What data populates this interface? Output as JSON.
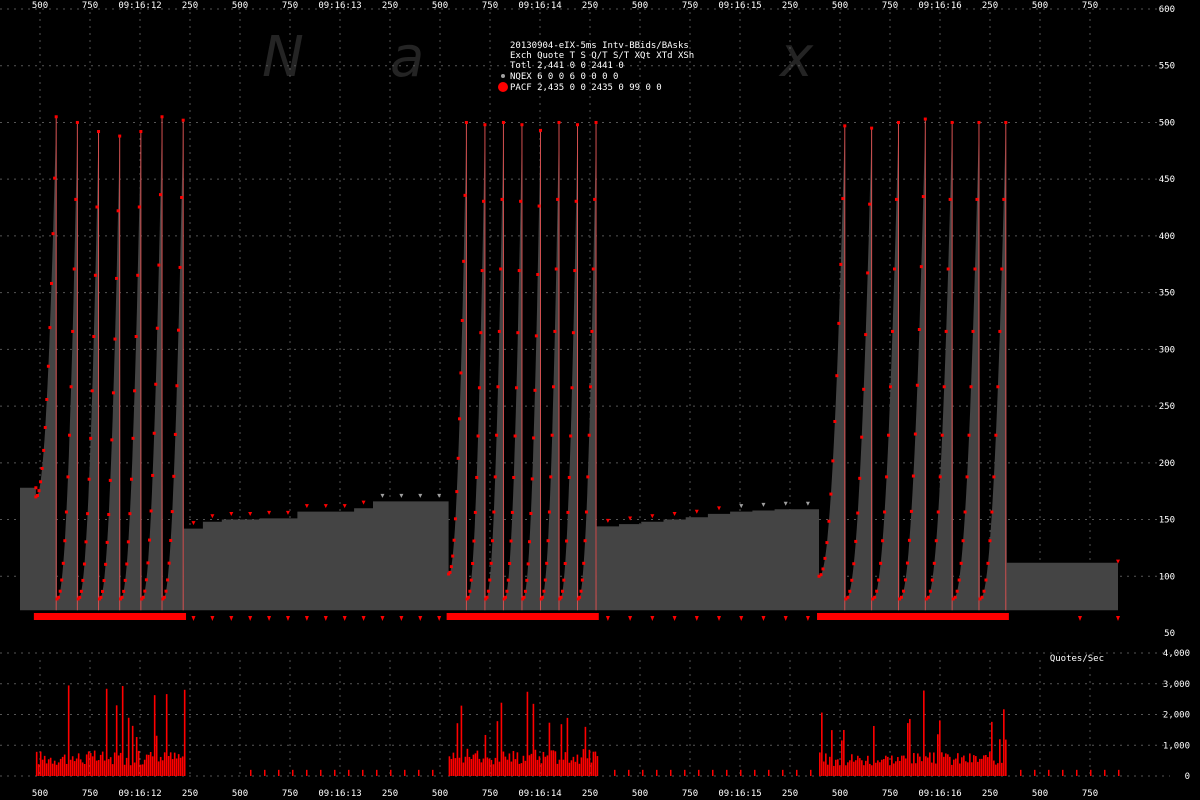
{
  "watermark": [
    "N",
    "a",
    "x"
  ],
  "legend": {
    "title": "20130904-eIX-5ms Intv-BBids/BAsks",
    "header": "Exch Quote T S  Q/T    S/T   XQt XTd XSh",
    "rows": [
      {
        "text": "Totl 2,441 0 0  2441      0",
        "marker": "none"
      },
      {
        "text": "NQEX     6 0 0     6      0   0   0   0",
        "marker": "small-gray-dot"
      },
      {
        "text": "PACF 2,435 0 0  2435      0  99   0   0",
        "marker": "large-red-dot"
      }
    ]
  },
  "colors": {
    "background": "#000000",
    "price_fill": "#444444",
    "pacf": "#ff0000",
    "nqex": "#a0a0a0",
    "grid": "#555555",
    "text": "#ffffff"
  },
  "chart_data": [
    {
      "type": "area",
      "description": "Top panel: stepped price level with quote markers (PACF red, NQEX gray); 5 sawtooth bursts ~500 to ~100 with flat ramps between",
      "y_ticks": [
        "600",
        "550",
        "500",
        "450",
        "400",
        "350",
        "300",
        "250",
        "200",
        "150",
        "100",
        "50"
      ],
      "ylim": [
        50,
        600
      ],
      "x_tick_labels": [
        "500",
        "750",
        "09:16:12",
        "250",
        "500",
        "750",
        "09:16:13",
        "250",
        "500",
        "750",
        "09:16:14",
        "250",
        "500",
        "750",
        "09:16:15",
        "250",
        "500",
        "750",
        "09:16:16",
        "250",
        "500",
        "750"
      ],
      "time_range_ms": [
        0,
        5400
      ],
      "base_level": 70,
      "segments": [
        {
          "kind": "flat",
          "t": [
            0,
            60
          ],
          "value": 178
        },
        {
          "kind": "sawtooth",
          "t": [
            60,
            620
          ],
          "low": 170,
          "peaks": [
            505,
            500,
            492,
            488,
            492,
            505,
            502
          ]
        },
        {
          "kind": "staircase",
          "t": [
            620,
            1620
          ],
          "steps": [
            142,
            148,
            150,
            150,
            151,
            151,
            157,
            157,
            157,
            160,
            166,
            166,
            166,
            166
          ]
        },
        {
          "kind": "sawtooth",
          "t": [
            1620,
            2180
          ],
          "low": 102,
          "peaks": [
            500,
            498,
            500,
            498,
            493,
            500,
            498,
            500
          ]
        },
        {
          "kind": "staircase",
          "t": [
            2180,
            3020
          ],
          "steps": [
            144,
            146,
            148,
            150,
            152,
            155,
            157,
            158,
            159,
            159
          ]
        },
        {
          "kind": "sawtooth",
          "t": [
            3020,
            3730
          ],
          "low": 100,
          "peaks": [
            497,
            495,
            500,
            503,
            500,
            500,
            500
          ]
        },
        {
          "kind": "flat",
          "t": [
            3730,
            4150
          ],
          "value": 112
        }
      ],
      "series": [
        {
          "name": "PACF",
          "color": "#ff0000",
          "marker": "dot",
          "points": 2435
        },
        {
          "name": "NQEX",
          "color": "#a0a0a0",
          "marker": "triangle",
          "points": 6
        }
      ]
    },
    {
      "type": "bar",
      "title": "Quotes/Sec",
      "y_ticks": [
        "4,000",
        "3,000",
        "2,000",
        "1,000",
        "0"
      ],
      "ylim": [
        0,
        4000
      ],
      "x_tick_labels": [
        "500",
        "750",
        "09:16:12",
        "250",
        "500",
        "750",
        "09:16:13",
        "250",
        "500",
        "750",
        "09:16:14",
        "250",
        "500",
        "750",
        "09:16:15",
        "250",
        "500",
        "750",
        "09:16:16",
        "250",
        "500",
        "750"
      ],
      "bursts": [
        {
          "t": [
            60,
            620
          ],
          "typical": 700,
          "max": 2950
        },
        {
          "t": [
            1620,
            2180
          ],
          "typical": 750,
          "max": 2980
        },
        {
          "t": [
            3020,
            3730
          ],
          "typical": 650,
          "max": 2850
        }
      ],
      "quiet_value": 200,
      "series": [
        {
          "name": "PACF",
          "color": "#ff0000"
        }
      ]
    }
  ]
}
